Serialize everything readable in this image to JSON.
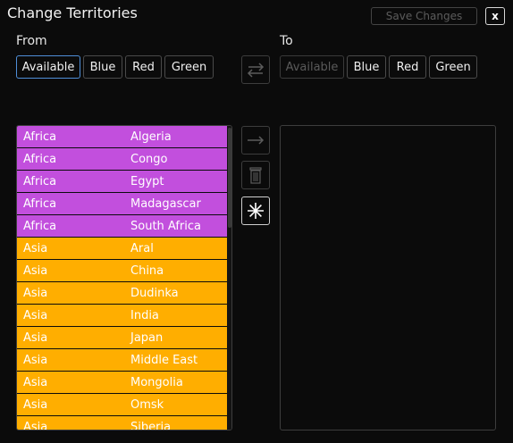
{
  "window": {
    "title": "Change Territories"
  },
  "toolbar": {
    "save_label": "Save Changes",
    "close_label": "x"
  },
  "from": {
    "label": "From",
    "filters": [
      "Available",
      "Blue",
      "Red",
      "Green"
    ],
    "selected": "Available"
  },
  "to": {
    "label": "To",
    "filters": [
      "Available",
      "Blue",
      "Red",
      "Green"
    ],
    "disabled": "Available"
  },
  "actions": {
    "swap_icon": "swap-arrows-icon",
    "move_icon": "arrow-right-icon",
    "delete_icon": "trash-icon",
    "select_all_icon": "asterisk-icon"
  },
  "colors": {
    "Africa": "#c24fdd",
    "Asia": "#ffae00",
    "accent": "#4f8fd8"
  },
  "territories": [
    {
      "region": "Africa",
      "name": "Algeria"
    },
    {
      "region": "Africa",
      "name": "Congo"
    },
    {
      "region": "Africa",
      "name": "Egypt"
    },
    {
      "region": "Africa",
      "name": "Madagascar"
    },
    {
      "region": "Africa",
      "name": "South Africa"
    },
    {
      "region": "Asia",
      "name": "Aral"
    },
    {
      "region": "Asia",
      "name": "China"
    },
    {
      "region": "Asia",
      "name": "Dudinka"
    },
    {
      "region": "Asia",
      "name": "India"
    },
    {
      "region": "Asia",
      "name": "Japan"
    },
    {
      "region": "Asia",
      "name": "Middle East"
    },
    {
      "region": "Asia",
      "name": "Mongolia"
    },
    {
      "region": "Asia",
      "name": "Omsk"
    },
    {
      "region": "Asia",
      "name": "Siberia"
    }
  ]
}
